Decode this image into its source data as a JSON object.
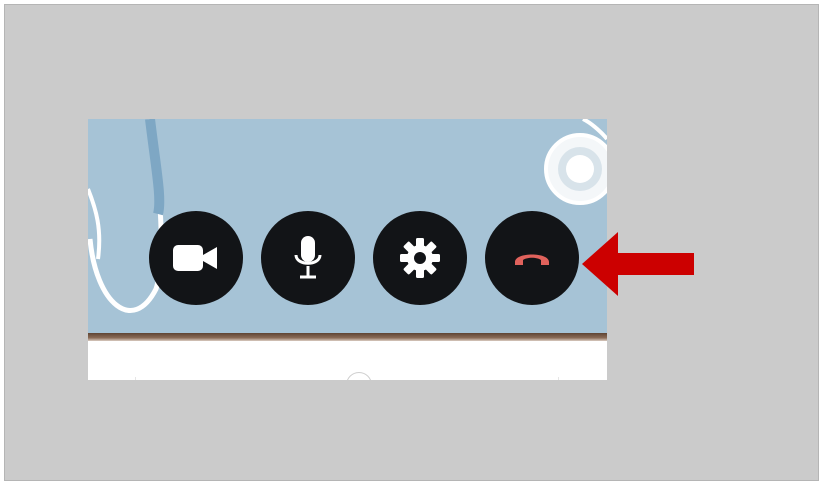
{
  "call_controls": {
    "buttons": [
      {
        "id": "camera",
        "icon": "video-camera-icon"
      },
      {
        "id": "microphone",
        "icon": "microphone-icon"
      },
      {
        "id": "settings",
        "icon": "gear-icon"
      },
      {
        "id": "end_call",
        "icon": "hang-up-phone-icon"
      }
    ]
  },
  "colors": {
    "outer_background": "#cbcbcb",
    "video_background": "#a6c3d6",
    "button_background": "#121417",
    "icon_color": "#ffffff",
    "hang_up_color": "#e0625c",
    "annotation_arrow": "#cc0000"
  },
  "annotation": {
    "type": "arrow",
    "points_to": "end_call"
  }
}
